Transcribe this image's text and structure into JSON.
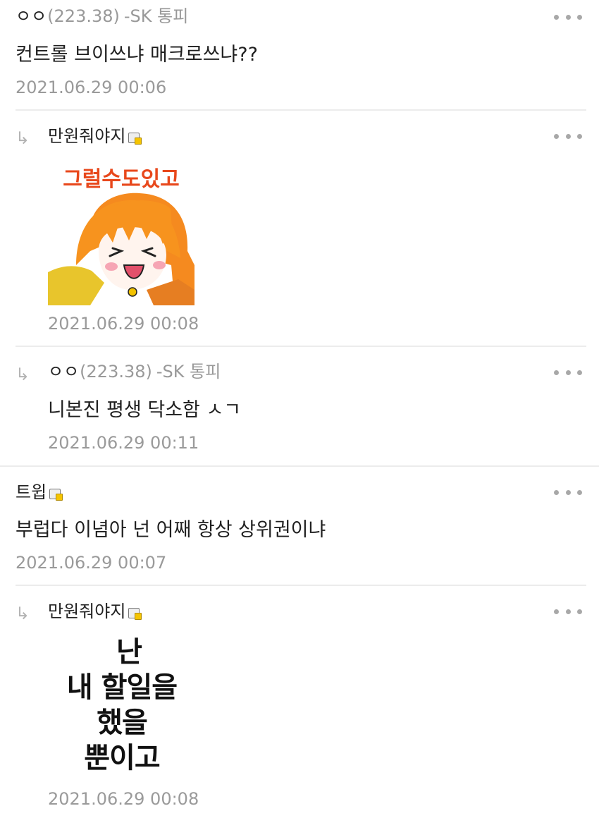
{
  "comments": [
    {
      "nick": "ㅇㅇ",
      "ip": "(223.38)",
      "telecom": "-SK 통피",
      "text": "컨트롤 브이쓰냐 매크로쓰냐??",
      "date": "2021.06.29 00:06"
    },
    {
      "nick": "만원줘야지",
      "text": "",
      "sticker": {
        "caption": "그럴수도있고"
      },
      "date": "2021.06.29 00:08"
    },
    {
      "nick": "ㅇㅇ",
      "ip": "(223.38)",
      "telecom": "-SK 통피",
      "text": "니본진 평생 닥소함 ㅅㄱ",
      "date": "2021.06.29 00:11"
    },
    {
      "nick": "트윕",
      "text": "부럽다 이념아 넌 어째 항상 상위권이냐",
      "date": "2021.06.29 00:07"
    },
    {
      "nick": "만원줘야지",
      "sticker": {
        "lines": [
          "난",
          "내 할일을",
          "했을",
          "뿐이고"
        ]
      },
      "date": "2021.06.29 00:08"
    }
  ],
  "icons": {
    "reply": "reply-arrow-icon",
    "more": "more-options-icon",
    "badge": "member-badge-icon"
  },
  "colors": {
    "nick": "#222222",
    "ip": "#999999",
    "date": "#9a9a9a",
    "divider": "#ececec",
    "badge_dot": "#f5c400"
  }
}
